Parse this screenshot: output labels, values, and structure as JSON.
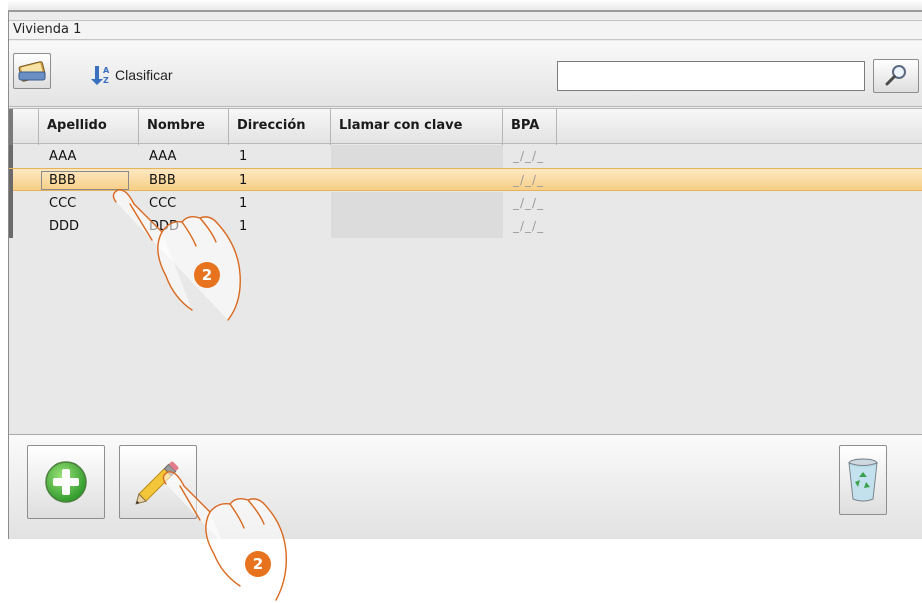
{
  "window": {
    "title": "Vivienda 1"
  },
  "toolbar": {
    "address_book_icon": "address-book-icon",
    "sort_label": "Clasificar",
    "sort_icon": "sort-az-icon",
    "search_value": "",
    "search_icon": "magnifier-icon"
  },
  "table": {
    "columns": [
      "Apellido",
      "Nombre",
      "Dirección",
      "Llamar con clave",
      "BPA"
    ],
    "rows": [
      {
        "apellido": "AAA",
        "nombre": "AAA",
        "direccion": "1",
        "clave": "",
        "bpa": "_/_/_"
      },
      {
        "apellido": "BBB",
        "nombre": "BBB",
        "direccion": "1",
        "clave": "",
        "bpa": "_/_/_"
      },
      {
        "apellido": "CCC",
        "nombre": "CCC",
        "direccion": "1",
        "clave": "",
        "bpa": "_/_/_"
      },
      {
        "apellido": "DDD",
        "nombre": "DDD",
        "direccion": "1",
        "clave": "",
        "bpa": "_/_/_"
      }
    ],
    "selected_row": 1
  },
  "bottombar": {
    "add_icon": "plus-circle-icon",
    "edit_icon": "pencil-icon",
    "delete_icon": "recycle-bin-icon"
  },
  "annotations": {
    "step_label": "2"
  },
  "colors": {
    "selection": "#f7cf86",
    "badge": "#e8731f"
  }
}
